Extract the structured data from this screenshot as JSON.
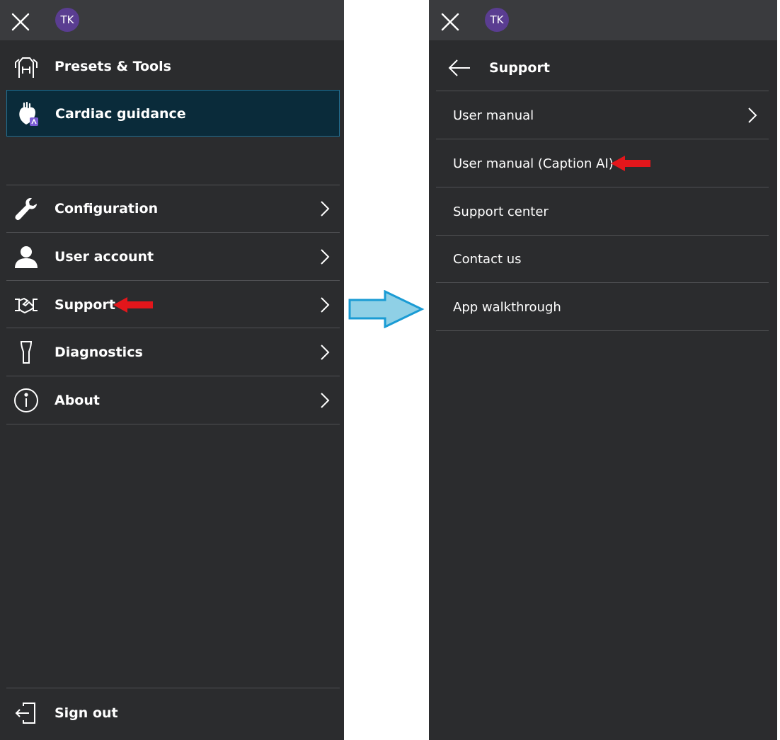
{
  "left_panel": {
    "avatar_initials": "TK",
    "menu_items": [
      {
        "label": "Presets & Tools",
        "icon": "presets-tools-icon"
      },
      {
        "label": "Cardiac guidance",
        "icon": "cardiac-guidance-icon",
        "selected": true
      },
      {
        "label": "Configuration",
        "icon": "wrench-icon"
      },
      {
        "label": "User account",
        "icon": "user-icon"
      },
      {
        "label": "Support",
        "icon": "handshake-icon"
      },
      {
        "label": "Diagnostics",
        "icon": "probe-icon"
      },
      {
        "label": "About",
        "icon": "info-icon"
      }
    ],
    "sign_out_label": "Sign out"
  },
  "right_panel": {
    "avatar_initials": "TK",
    "header_title": "Support",
    "items": [
      {
        "label": "User manual",
        "has_chevron": true
      },
      {
        "label": "User manual (Caption AI)"
      },
      {
        "label": "Support center"
      },
      {
        "label": "Contact us"
      },
      {
        "label": "App walkthrough"
      }
    ]
  },
  "colors": {
    "panel_bg": "#2b2c2e",
    "topbar_bg": "#3a3b3e",
    "avatar_bg": "#5a3d91",
    "selected_bg": "#0a2b3a",
    "selected_border": "#1f6f93",
    "annotation_red": "#e3161b",
    "annotation_blue": "#8fd0e6"
  }
}
